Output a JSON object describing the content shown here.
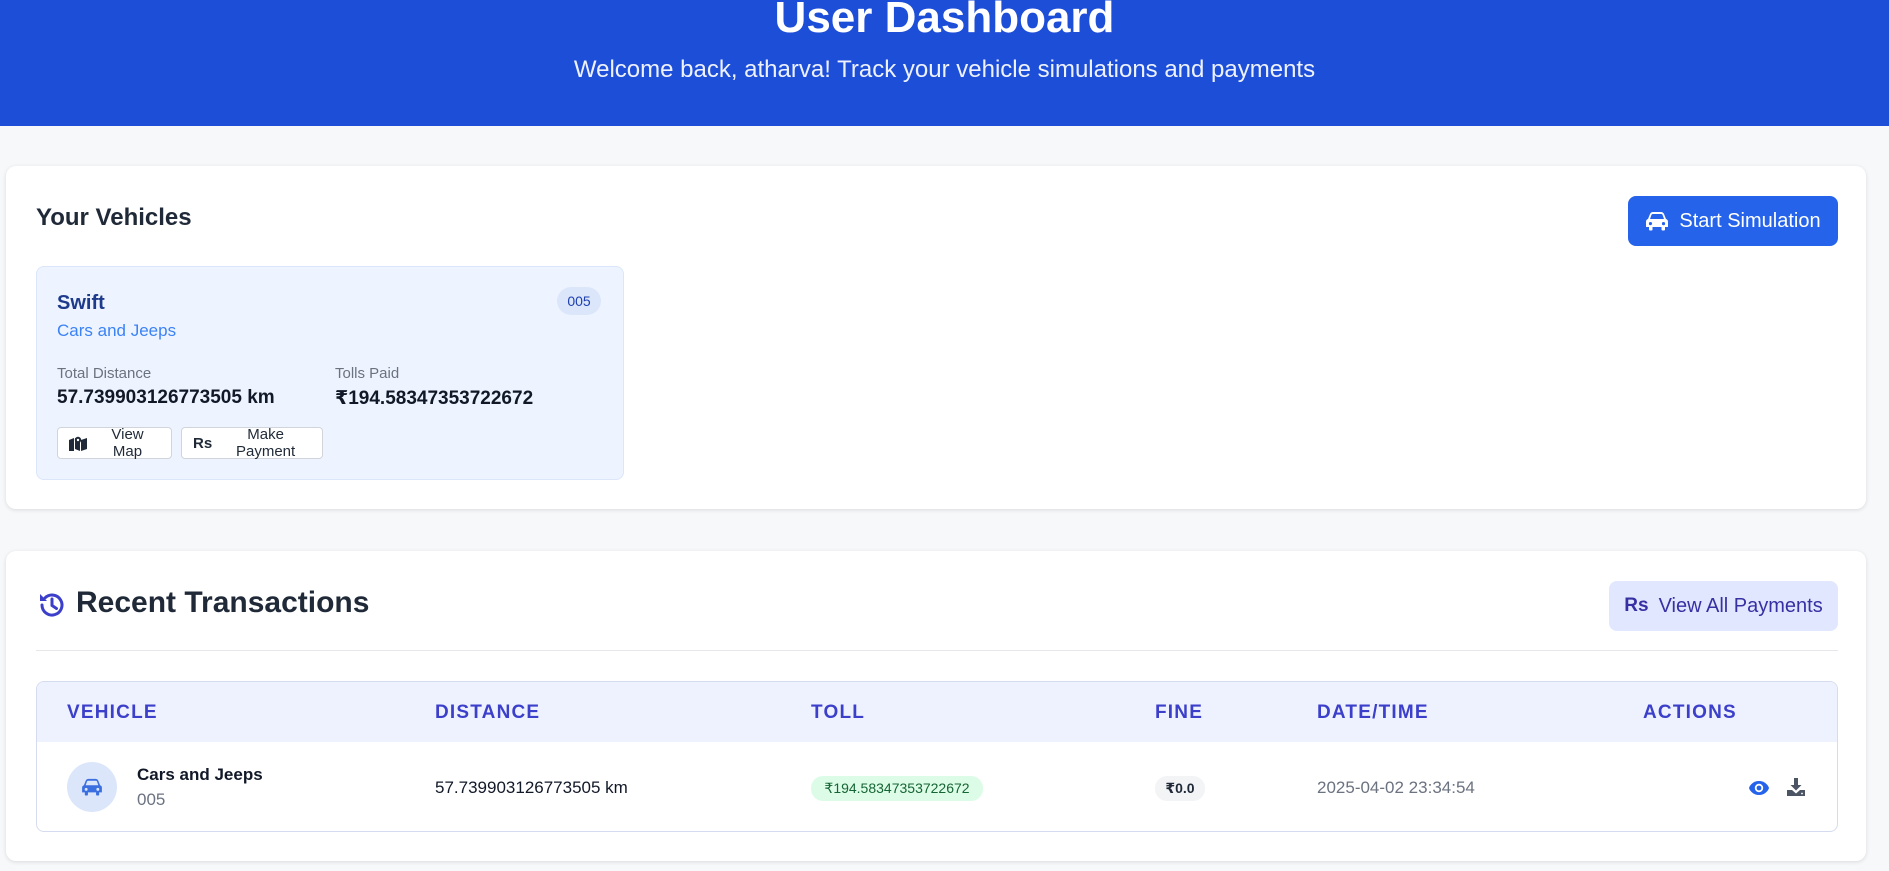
{
  "header": {
    "title": "User Dashboard",
    "subtitle": "Welcome back, atharva! Track your vehicle simulations and payments"
  },
  "vehicles_section": {
    "title": "Your Vehicles",
    "start_button": "Start Simulation",
    "vehicles": [
      {
        "name": "Swift",
        "type": "Cars and Jeeps",
        "badge": "005",
        "distance_label": "Total Distance",
        "distance_value": "57.739903126773505 km",
        "tolls_label": "Tolls Paid",
        "tolls_value": "₹194.58347353722672",
        "view_map_label": "View Map",
        "make_payment_label": "Make Payment"
      }
    ]
  },
  "transactions_section": {
    "title": "Recent Transactions",
    "view_all_button": "View All Payments",
    "columns": [
      "VEHICLE",
      "DISTANCE",
      "TOLL",
      "FINE",
      "DATE/TIME",
      "ACTIONS"
    ],
    "rows": [
      {
        "vehicle_type": "Cars and Jeeps",
        "vehicle_id": "005",
        "distance": "57.739903126773505 km",
        "toll": "₹194.58347353722672",
        "fine": "₹0.0",
        "datetime": "2025-04-02 23:34:54"
      }
    ]
  },
  "icons": {
    "start_button": "car-icon",
    "view_map": "map-icon",
    "make_payment": "rupee-icon",
    "history": "history-icon",
    "view_all": "rupee-icon",
    "row_vehicle": "car-icon",
    "view_action": "eye-icon",
    "download_action": "download-icon"
  },
  "colors": {
    "header_bg": "#1d4ed8",
    "primary": "#2563eb",
    "accent_indigo": "#3b3fc9",
    "toll_pill_bg": "#dcfce7",
    "toll_pill_text": "#166534"
  }
}
